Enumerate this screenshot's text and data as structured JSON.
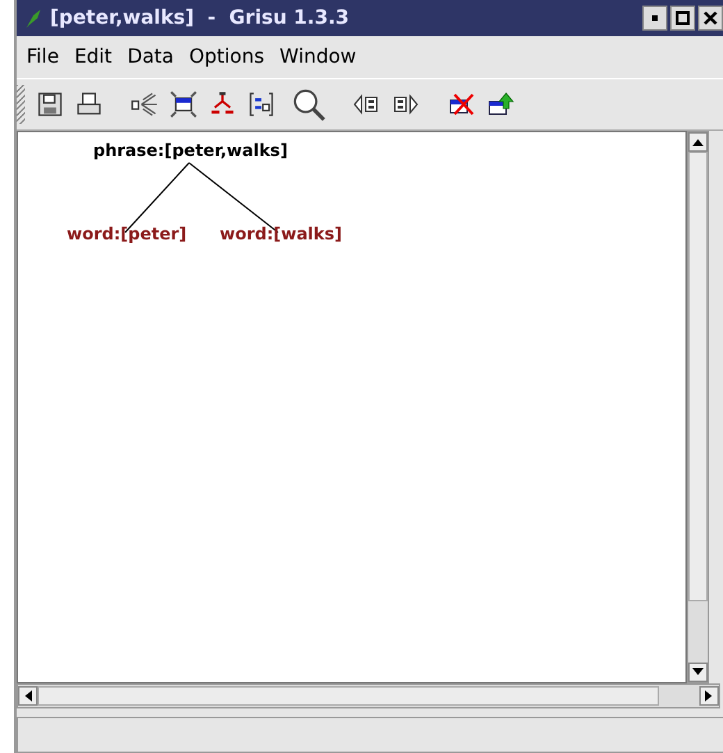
{
  "window": {
    "title": "[peter,walks]  -  Grisu 1.3.3"
  },
  "menu": [
    "File",
    "Edit",
    "Data",
    "Options",
    "Window"
  ],
  "tree": {
    "label": "phrase:[peter,walks]",
    "children": [
      {
        "label": "word:[peter]",
        "kind": "leaf"
      },
      {
        "label": "word:[walks]",
        "kind": "leaf"
      }
    ]
  }
}
